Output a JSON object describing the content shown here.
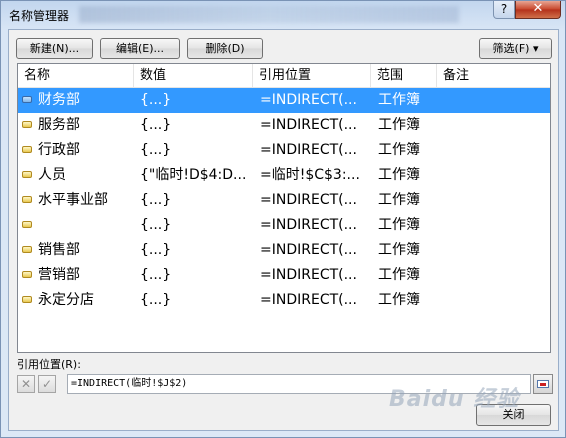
{
  "window": {
    "title": "名称管理器",
    "help_label": "?",
    "close_label": "✕"
  },
  "toolbar": {
    "new_label": "新建(N)...",
    "edit_label": "编辑(E)...",
    "delete_label": "删除(D)",
    "filter_label": "筛选(F) ▾"
  },
  "table": {
    "columns": [
      "名称",
      "数值",
      "引用位置",
      "范围",
      "备注"
    ],
    "rows": [
      {
        "name": "财务部",
        "value": "{...}",
        "ref": "=INDIRECT(...",
        "scope": "工作簿",
        "note": "",
        "selected": true
      },
      {
        "name": "服务部",
        "value": "{...}",
        "ref": "=INDIRECT(...",
        "scope": "工作簿",
        "note": ""
      },
      {
        "name": "行政部",
        "value": "{...}",
        "ref": "=INDIRECT(...",
        "scope": "工作簿",
        "note": ""
      },
      {
        "name": "人员",
        "value": "{\"临时!D$4:D...",
        "ref": "=临时!$C$3:...",
        "scope": "工作簿",
        "note": ""
      },
      {
        "name": "水平事业部",
        "value": "{...}",
        "ref": "=INDIRECT(...",
        "scope": "工作簿",
        "note": ""
      },
      {
        "name": "",
        "value": "{...}",
        "ref": "=INDIRECT(...",
        "scope": "工作簿",
        "note": ""
      },
      {
        "name": "销售部",
        "value": "{...}",
        "ref": "=INDIRECT(...",
        "scope": "工作簿",
        "note": ""
      },
      {
        "name": "营销部",
        "value": "{...}",
        "ref": "=INDIRECT(...",
        "scope": "工作簿",
        "note": ""
      },
      {
        "name": "永定分店",
        "value": "{...}",
        "ref": "=INDIRECT(...",
        "scope": "工作簿",
        "note": ""
      }
    ]
  },
  "reference": {
    "label": "引用位置(R):",
    "value": "=INDIRECT(临时!$J$2)",
    "cancel_glyph": "✕",
    "confirm_glyph": "✓"
  },
  "footer": {
    "close_label": "关闭"
  },
  "watermark": "Baidu 经验",
  "colors": {
    "selection": "#3399ff",
    "title_bar": "#c2d6ee",
    "close_button": "#c7452a"
  }
}
